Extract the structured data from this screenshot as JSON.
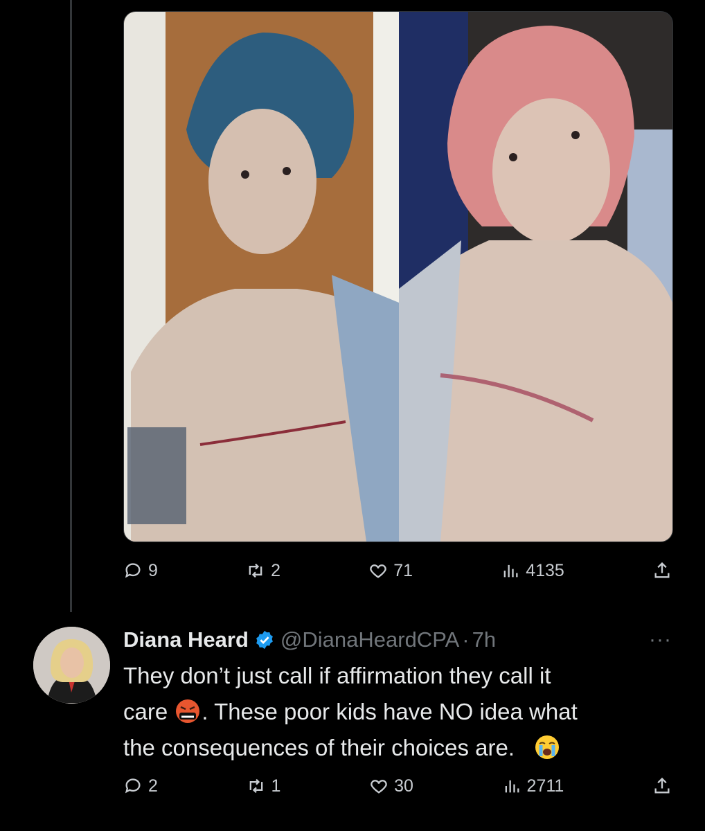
{
  "colors": {
    "background": "#000000",
    "text_primary": "#e7e9ea",
    "text_secondary": "#71767b",
    "verified_blue": "#1d9bf0"
  },
  "top_tweet": {
    "media_description": "two-photo collage",
    "metrics": {
      "replies": "9",
      "retweets": "2",
      "likes": "71",
      "views": "4135"
    }
  },
  "reply_tweet": {
    "author_name": "Diana Heard",
    "handle": "@DianaHeardCPA",
    "separator": "·",
    "time": "7h",
    "more_label": "···",
    "text_line1": "They don’t just call if affirmation they call it",
    "text_line2a": "care",
    "text_line2b": ". These poor kids have NO idea what",
    "text_line3": "the consequences of their choices are.",
    "icons": [
      "verified-badge-icon",
      "angry-cursing-face-emoji",
      "crying-face-emoji"
    ],
    "metrics": {
      "replies": "2",
      "retweets": "1",
      "likes": "30",
      "views": "2711"
    }
  }
}
